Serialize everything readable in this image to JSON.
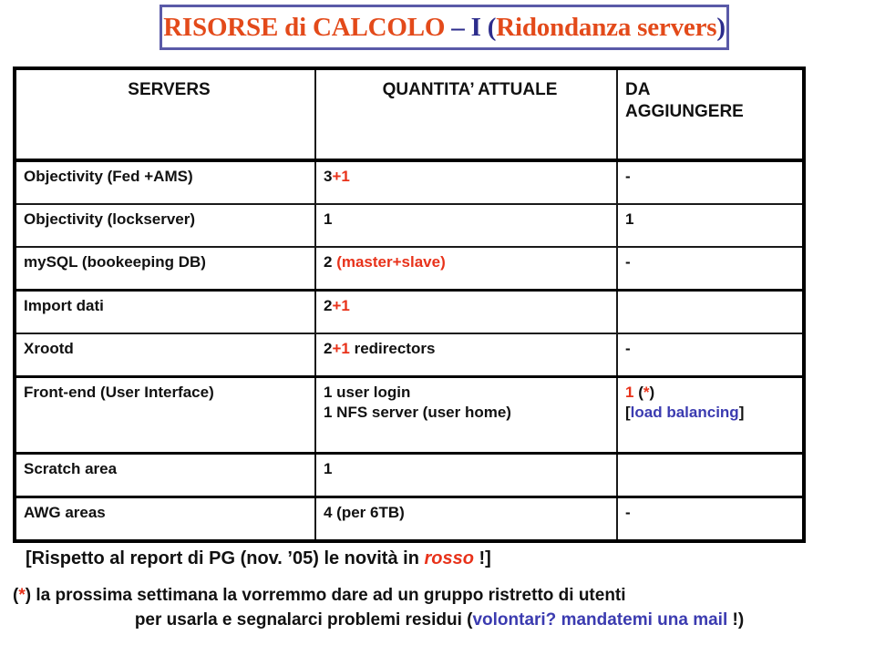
{
  "title": {
    "part1": "RISORSE di CALCOLO ",
    "part2": "– I (",
    "part3": "Ridondanza servers",
    "part4": ")"
  },
  "table": {
    "headers": {
      "col1": "SERVERS",
      "col2": "QUANTITA’ ATTUALE",
      "col3_line1": "DA",
      "col3_line2": "AGGIUNGERE"
    },
    "rows": [
      {
        "server": "Objectivity (Fed +AMS)",
        "qty_black": "3",
        "qty_red": "+1",
        "qty_tail": "",
        "add": "-"
      },
      {
        "server": "Objectivity (lockserver)",
        "qty_black": "1",
        "qty_red": "",
        "qty_tail": "",
        "add": "1"
      },
      {
        "server": "mySQL (bookeeping DB)",
        "qty_black": "2 ",
        "qty_red": "(master+slave)",
        "qty_tail": "",
        "add": "-"
      },
      {
        "server": "Import dati",
        "qty_black": "2",
        "qty_red": "+1",
        "qty_tail": "",
        "add": ""
      },
      {
        "server": "Xrootd",
        "qty_black": "2",
        "qty_red": "+1",
        "qty_tail": " redirectors",
        "add": "-"
      },
      {
        "server": "Front-end (User Interface)",
        "qty_line1": "1 user login",
        "qty_line2": "1 NFS server (user home)",
        "add_l1_red": "1",
        "add_l1_open": " (",
        "add_l1_star": "*",
        "add_l1_close": ")",
        "add_l2_open": "[",
        "add_l2_blue": "load balancing",
        "add_l2_close": "]"
      },
      {
        "server": "Scratch area",
        "qty_black": "1",
        "qty_red": "",
        "qty_tail": "",
        "add": ""
      },
      {
        "server": "AWG areas",
        "qty_black": "4 (per 6TB)",
        "qty_red": "",
        "qty_tail": "",
        "add": "-"
      }
    ]
  },
  "footer": {
    "line1_a": "[Rispetto al report di PG (nov. ’05) le novità in ",
    "line1_red": "rosso",
    "line1_b": " !]",
    "note_star_open": "(",
    "note_star": "*",
    "note_star_close": ") ",
    "note_text1": "la prossima settimana la vorremmo dare ad un gruppo ristretto di utenti",
    "note_text2a": "per usarla e segnalarci problemi residui (",
    "note_text2_blue": "volontari? mandatemi una mail",
    "note_text2b": " !)"
  },
  "colors": {
    "accent_orange": "#e34a1a",
    "accent_navy": "#2c2c8c",
    "accent_red": "#e8321a",
    "accent_blue": "#3b3bb0",
    "border_blue": "#5a5aa8"
  }
}
